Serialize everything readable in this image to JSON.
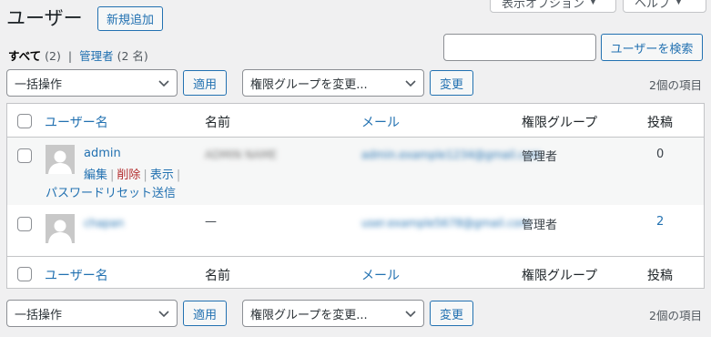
{
  "header": {
    "title": "ユーザー",
    "add_new_label": "新規追加",
    "screen_options_label": "表示オプション",
    "help_label": "ヘルプ"
  },
  "filters": {
    "all_label": "すべて",
    "all_count": "(2)",
    "separator": "|",
    "admin_label": "管理者",
    "admin_count": "(2 名)"
  },
  "search": {
    "value": "",
    "button_label": "ユーザーを検索"
  },
  "bulk_actions": {
    "selected": "一括操作",
    "apply_label": "適用",
    "role_selected": "権限グループを変更...",
    "change_label": "変更",
    "item_count": "2個の項目"
  },
  "table": {
    "columns": {
      "username": "ユーザー名",
      "name": "名前",
      "email": "メール",
      "role": "権限グループ",
      "posts": "投稿"
    },
    "rows": [
      {
        "username": "admin",
        "name_redacted": "ADMIN NAME",
        "email_redacted": "admin.example1234@gmail.com",
        "role": "管理者",
        "posts": "0",
        "actions": {
          "edit": "編集",
          "delete": "削除",
          "view": "表示",
          "reset_password": "パスワードリセット送信",
          "sep": "|"
        }
      },
      {
        "username_redacted": "chapan",
        "name": "—",
        "email_redacted": "user.example5678@gmail.com",
        "role": "管理者",
        "posts": "2"
      }
    ]
  },
  "colors": {
    "background": "#f0f0f1",
    "link": "#2271b1",
    "delete": "#b32d2e",
    "border": "#c3c4c7"
  }
}
